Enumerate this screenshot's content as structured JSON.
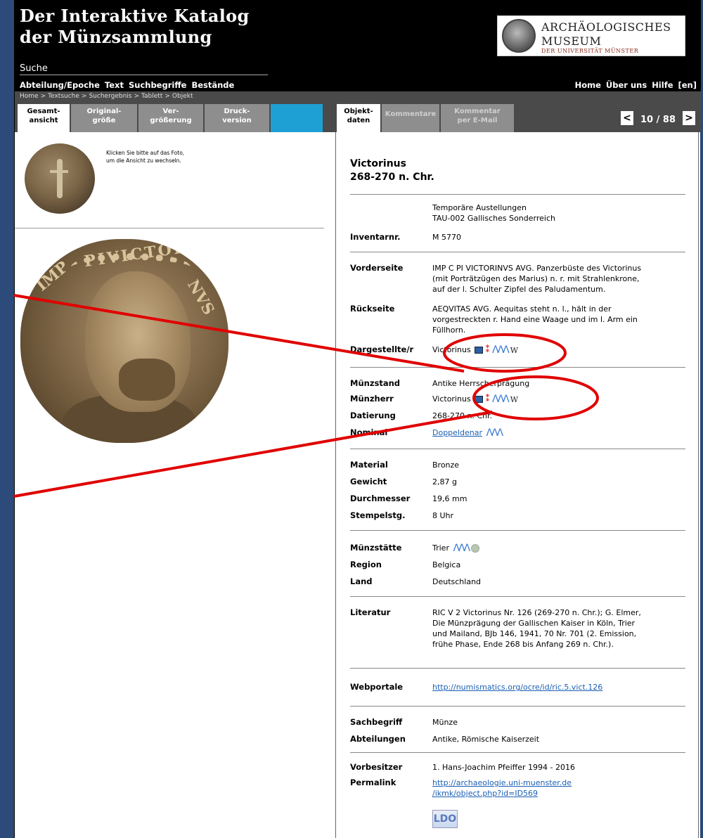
{
  "header": {
    "title_line1": "Der Interaktive Katalog",
    "title_line2": "der Münzsammlung",
    "section": "Suche",
    "logo": {
      "line1": "ARCHÄOLOGISCHES",
      "line2": "MUSEUM",
      "line3": "DER UNIVERSITÄT MÜNSTER"
    }
  },
  "nav": {
    "left": [
      "Abteilung/Epoche",
      "Text",
      "Suchbegriffe",
      "Bestände"
    ],
    "right": [
      "Home",
      "Über uns",
      "Hilfe",
      "[en]"
    ]
  },
  "breadcrumb": [
    "Home",
    ">",
    "Textsuche",
    ">",
    "Suchergebnis",
    ">",
    "Tablett",
    ">",
    "Objekt"
  ],
  "tabs_left": [
    {
      "line1": "Gesamt-",
      "line2": "ansicht"
    },
    {
      "line1": "Original-",
      "line2": "größe"
    },
    {
      "line1": "Ver-",
      "line2": "größerung"
    },
    {
      "line1": "Druck-",
      "line2": "version"
    }
  ],
  "tabs_right": [
    {
      "line1": "Objekt-",
      "line2": "daten"
    },
    {
      "line1": "Kommentare",
      "line2": ""
    },
    {
      "line1": "Kommentar",
      "line2": "per E-Mail"
    }
  ],
  "pager": {
    "prev": "<",
    "next": ">",
    "count": "10 / 88"
  },
  "left": {
    "hint_line1": "Klicken Sie bitte auf das Foto,",
    "hint_line2": "um die Ansicht zu wechseln.",
    "coin_legend": "IMP C PI VICTORINVS AVG"
  },
  "object": {
    "name": "Victorinus",
    "date": "268-270 n. Chr.",
    "exhibition_line1": "Temporäre Austellungen",
    "exhibition_line2": "TAU-002 Gallisches Sonderreich",
    "inventar": {
      "label": "Inventarnr.",
      "value": "M 5770"
    },
    "vorderseite": {
      "label": "Vorderseite",
      "line1": "IMP C PI VICTORINVS AVG. Panzerbüste des Victorinus",
      "line2": "(mit Porträtzügen des Marius) n. r. mit Strahlenkrone,",
      "line3": "auf der l. Schulter Zipfel des Paludamentum."
    },
    "rueckseite": {
      "label": "Rückseite",
      "line1": "AEQVITAS AVG. Aequitas steht n. l., hält in der",
      "line2": "vorgestreckten r. Hand eine Waage und im l. Arm ein",
      "line3": "Füllhorn."
    },
    "dargestellte": {
      "label": "Dargestellte/r",
      "value": "Victorinus"
    },
    "muenzstand": {
      "label": "Münzstand",
      "value": "Antike Herrscherprägung"
    },
    "muenzherr": {
      "label": "Münzherr",
      "value": "Victorinus"
    },
    "datierung": {
      "label": "Datierung",
      "value": "268-270 n. Chr."
    },
    "nominal": {
      "label": "Nominal",
      "value": "Doppeldenar"
    },
    "material": {
      "label": "Material",
      "value": "Bronze"
    },
    "gewicht": {
      "label": "Gewicht",
      "value": "2,87 g"
    },
    "durchmesser": {
      "label": "Durchmesser",
      "value": "19,6 mm"
    },
    "stempelstg": {
      "label": "Stempelstg.",
      "value": "8 Uhr"
    },
    "muenzstaette": {
      "label": "Münzstätte",
      "value": "Trier"
    },
    "region": {
      "label": "Region",
      "value": "Belgica"
    },
    "land": {
      "label": "Land",
      "value": "Deutschland"
    },
    "literatur": {
      "label": "Literatur",
      "line1": "RIC V 2 Victorinus Nr. 126 (269-270 n. Chr.); G. Elmer,",
      "line2": "Die Münzprägung der Gallischen Kaiser in Köln, Trier",
      "line3": "und Mailand, BJb 146, 1941, 70 Nr. 701 (2. Emission,",
      "line4": "frühe Phase, Ende 268 bis Anfang 269 n. Chr.)."
    },
    "webportale": {
      "label": "Webportale",
      "value": "http://numismatics.org/ocre/id/ric.5.vict.126"
    },
    "sachbegriff": {
      "label": "Sachbegriff",
      "value": "Münze"
    },
    "abteilungen": {
      "label": "Abteilungen",
      "value": "Antike, Römische Kaiserzeit"
    },
    "vorbesitzer": {
      "label": "Vorbesitzer",
      "value": "1. Hans-Joachim Pfeiffer 1994 - 2016"
    },
    "permalink": {
      "label": "Permalink",
      "line1": "http://archaeologie.uni-muenster.de",
      "line2": "/ikmk/object.php?id=ID569"
    },
    "ldo_badge": "LDO"
  },
  "icon_labels": {
    "mm": "ΛΛΛ",
    "w": "W",
    "red": "⁑"
  },
  "colors": {
    "header_bg": "#000000",
    "link": "#1a5fb4",
    "accent_tab": "#1ea0d4",
    "annotation": "#e00000",
    "frame": "#2c4a7a"
  }
}
